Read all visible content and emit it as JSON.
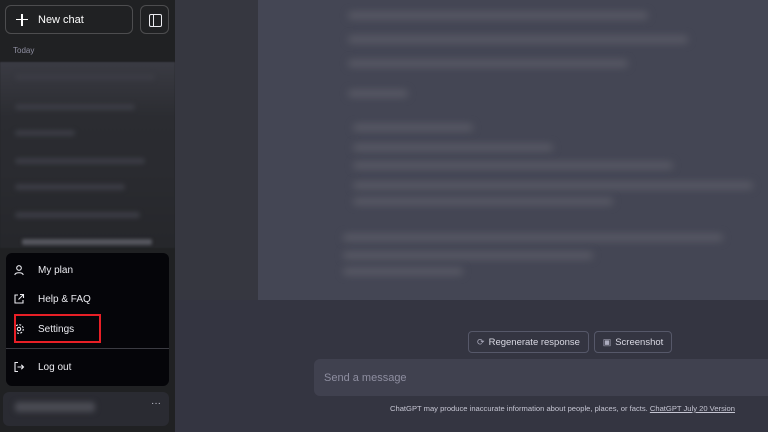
{
  "sidebar": {
    "new_chat_label": "New chat",
    "section_today": "Today"
  },
  "menu": {
    "items": [
      {
        "label": "My plan",
        "icon": "user-icon"
      },
      {
        "label": "Help & FAQ",
        "icon": "external-link-icon"
      },
      {
        "label": "Settings",
        "icon": "gear-icon"
      },
      {
        "label": "Log out",
        "icon": "logout-icon"
      }
    ]
  },
  "user": {
    "more_label": "···"
  },
  "main": {
    "regenerate_label": "Regenerate response",
    "screenshot_label": "Screenshot",
    "input_placeholder": "Send a message",
    "footer_text": "ChatGPT may produce inaccurate information about people, places, or facts. ",
    "footer_link": "ChatGPT July 20 Version"
  },
  "colors": {
    "sidebar_bg": "#202123",
    "menu_bg": "#050509",
    "main_bg": "#343541",
    "highlight": "#e81f26"
  }
}
